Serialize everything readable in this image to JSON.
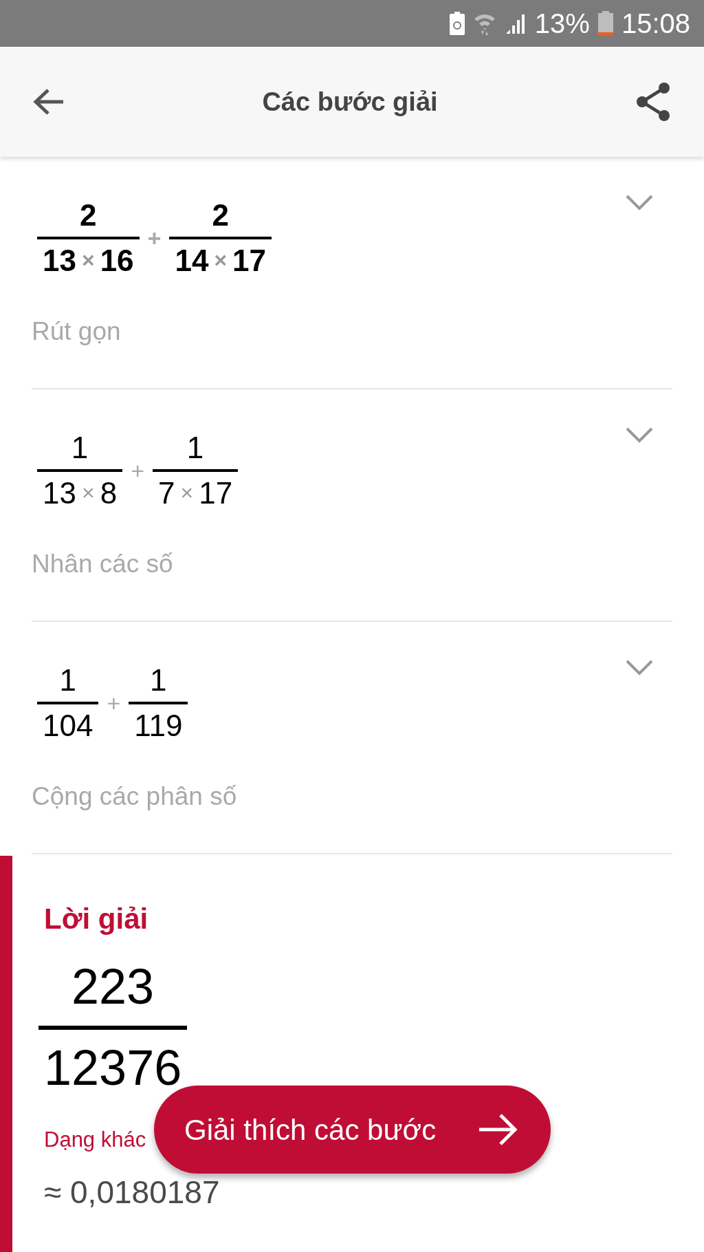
{
  "status_bar": {
    "battery": "13%",
    "time": "15:08"
  },
  "header": {
    "title": "Các bước giải"
  },
  "steps": [
    {
      "bold": true,
      "expanded": false,
      "label": "Rút gọn",
      "terms": [
        {
          "numerator": "2",
          "denominator": [
            "13",
            "×",
            "16"
          ]
        },
        {
          "operator": "+"
        },
        {
          "numerator": "2",
          "denominator": [
            "14",
            "×",
            "17"
          ]
        }
      ]
    },
    {
      "bold": false,
      "expanded": false,
      "label": "Nhân các số",
      "terms": [
        {
          "numerator": "1",
          "denominator": [
            "13",
            "×",
            "8"
          ]
        },
        {
          "operator": "+"
        },
        {
          "numerator": "1",
          "denominator": [
            "7",
            "×",
            "17"
          ]
        }
      ]
    },
    {
      "bold": false,
      "expanded": false,
      "label": "Cộng các phân số",
      "terms": [
        {
          "numerator": "1",
          "denominator": [
            "104"
          ]
        },
        {
          "operator": "+"
        },
        {
          "numerator": "1",
          "denominator": [
            "119"
          ]
        }
      ]
    }
  ],
  "solution": {
    "title": "Lời giải",
    "numerator": "223",
    "denominator": "12376",
    "alt_title": "Dạng khác",
    "alt_value": "≈ 0,0180187"
  },
  "fab": {
    "label": "Giải thích các bước"
  }
}
